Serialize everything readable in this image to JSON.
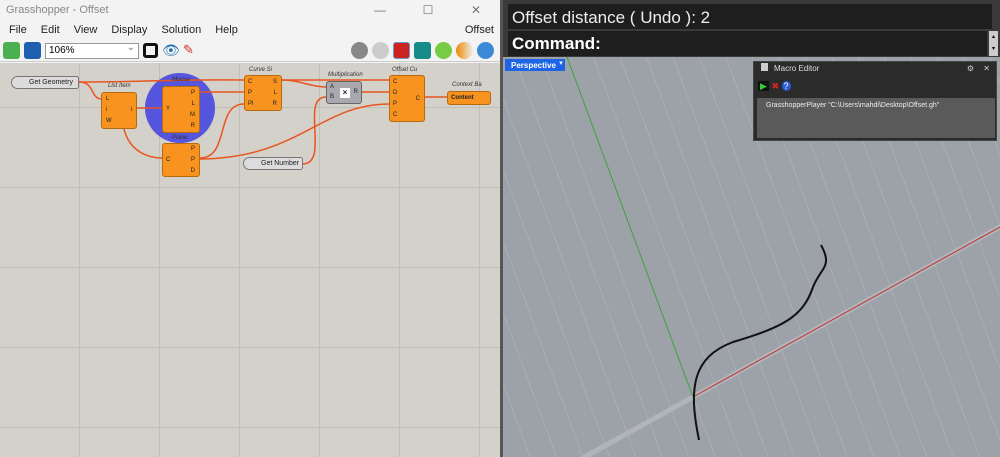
{
  "window": {
    "title": "Grasshopper - Offset",
    "doc_name": "Offset"
  },
  "menu": [
    "File",
    "Edit",
    "View",
    "Display",
    "Solution",
    "Help"
  ],
  "toolbar": {
    "zoom": "106%"
  },
  "components": {
    "get_geometry": "Get Geometry",
    "list_item": {
      "title": "List Item",
      "inputs": [
        "L",
        "i",
        "W"
      ],
      "outputs": [
        "i"
      ]
    },
    "mouse": {
      "title": "Mouse",
      "inputs": [
        "Y"
      ],
      "outputs": [
        "P",
        "L",
        "M",
        "R"
      ]
    },
    "plane": {
      "title": "Plane",
      "inputs": [
        "C"
      ],
      "outputs": [
        "P",
        "P",
        "D"
      ]
    },
    "curve_side": {
      "title": "Curve Si",
      "inputs": [
        "C",
        "P",
        "Pl"
      ],
      "outputs": [
        "S",
        "L",
        "R"
      ]
    },
    "multiplication": {
      "title": "Multiplication",
      "inputs": [
        "A",
        "B"
      ],
      "outputs": [
        "R"
      ]
    },
    "offset_curve": {
      "title": "Offset Cu",
      "inputs": [
        "C",
        "D",
        "P",
        "C"
      ],
      "outputs": [
        "C"
      ]
    },
    "context_bake": {
      "title": "Context Ba",
      "input": "Content"
    },
    "get_number": "Get Number"
  },
  "rhino": {
    "history": "Offset distance ( Undo ): 2",
    "command": "Command:",
    "viewport": "Perspective",
    "macro_editor": {
      "title": "Macro Editor",
      "text": "GrasshopperPlayer \"C:\\Users\\mahdi\\Desktop\\Offset.gh\""
    }
  }
}
